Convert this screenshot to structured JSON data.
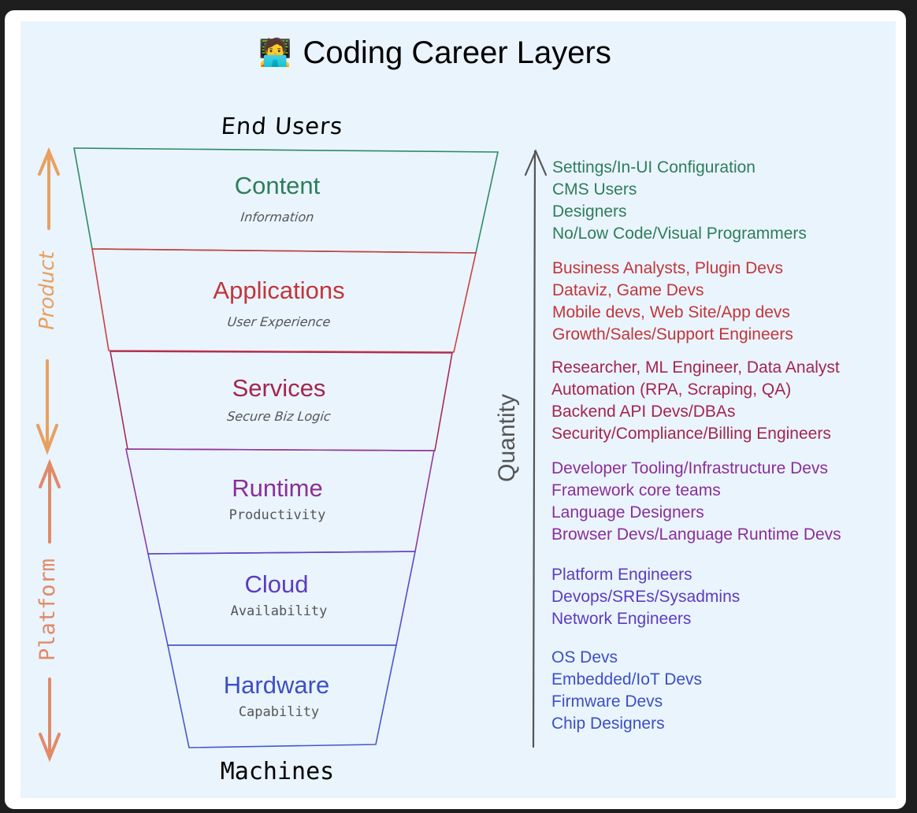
{
  "title": {
    "emoji": "🧑‍💻",
    "emoji_name": "woman-technologist-icon",
    "text": "Coding Career Layers"
  },
  "top_label": "End Users",
  "bottom_label": "Machines",
  "side_labels": {
    "product": "Product",
    "platform": "Platform",
    "quantity": "Quantity"
  },
  "layers": [
    {
      "name": "Content",
      "subtitle": "Information",
      "color": "#2e7d5b"
    },
    {
      "name": "Applications",
      "subtitle": "User Experience",
      "color": "#c0363a"
    },
    {
      "name": "Services",
      "subtitle": "Secure Biz Logic",
      "color": "#a3264e"
    },
    {
      "name": "Runtime",
      "subtitle": "Productivity",
      "color": "#8a2f98"
    },
    {
      "name": "Cloud",
      "subtitle": "Availability",
      "color": "#5b3cbf"
    },
    {
      "name": "Hardware",
      "subtitle": "Capability",
      "color": "#3d4fc4"
    }
  ],
  "role_groups": [
    {
      "layer": "Content",
      "color": "#2e7d5b",
      "roles": [
        "Settings/In-UI Configuration",
        "CMS Users",
        "Designers",
        "No/Low Code/Visual Programmers"
      ]
    },
    {
      "layer": "Applications",
      "color": "#c0363a",
      "roles": [
        "Business Analysts, Plugin Devs",
        "Dataviz, Game Devs",
        "Mobile devs, Web Site/App devs",
        "Growth/Sales/Support Engineers"
      ]
    },
    {
      "layer": "Services",
      "color": "#a3264e",
      "roles": [
        "Researcher, ML Engineer, Data Analyst",
        "Automation (RPA, Scraping, QA)",
        "Backend API Devs/DBAs",
        "Security/Compliance/Billing Engineers"
      ]
    },
    {
      "layer": "Runtime",
      "color": "#8a2f98",
      "roles": [
        "Developer Tooling/Infrastructure Devs",
        "Framework core teams",
        "Language Designers",
        "Browser Devs/Language Runtime Devs"
      ]
    },
    {
      "layer": "Cloud",
      "color": "#5b3cbf",
      "roles": [
        "Platform Engineers",
        "Devops/SREs/Sysadmins",
        "Network Engineers"
      ]
    },
    {
      "layer": "Hardware",
      "color": "#3d4fc4",
      "roles": [
        "OS Devs",
        "Embedded/IoT Devs",
        "Firmware Devs",
        "Chip Designers"
      ]
    }
  ],
  "colors": {
    "background": "#1e1e1e",
    "card": "#ffffff",
    "panel": "#eaf4fd",
    "product_arrow": "#e8a060",
    "platform_arrow": "#e08a68",
    "quantity_arrow": "#555555"
  }
}
